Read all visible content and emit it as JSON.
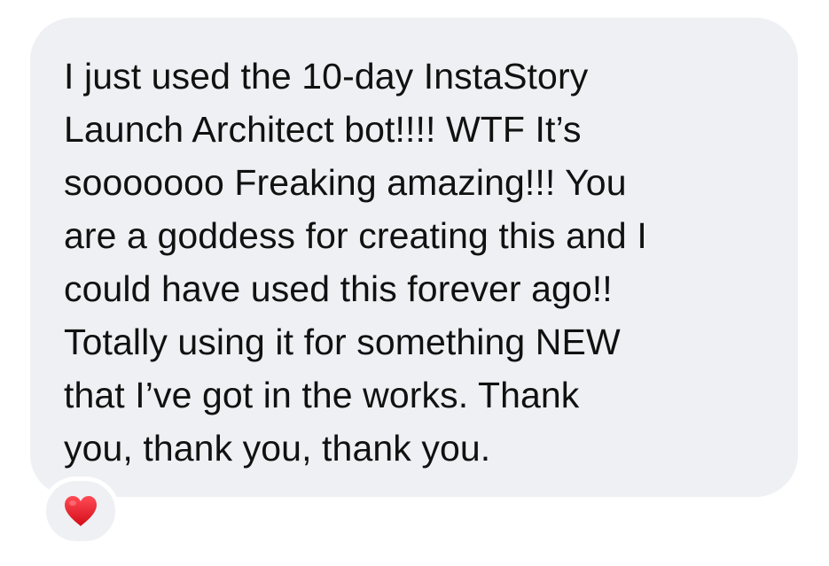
{
  "message": {
    "lines": [
      "I just used the 10-day InstaStory",
      "Launch Architect bot!!!! WTF It’s",
      "sooooooo Freaking amazing!!! You",
      "are a goddess for creating this and I",
      "could have used this forever ago!!",
      "Totally using it for something NEW",
      "that I’ve got in the works. Thank",
      "you, thank you, thank you."
    ]
  },
  "reaction": {
    "icon": "heart-icon",
    "color": "#e8151f"
  },
  "colors": {
    "bubble_background": "#eff0f3",
    "text": "#111111",
    "page_background": "#ffffff"
  }
}
